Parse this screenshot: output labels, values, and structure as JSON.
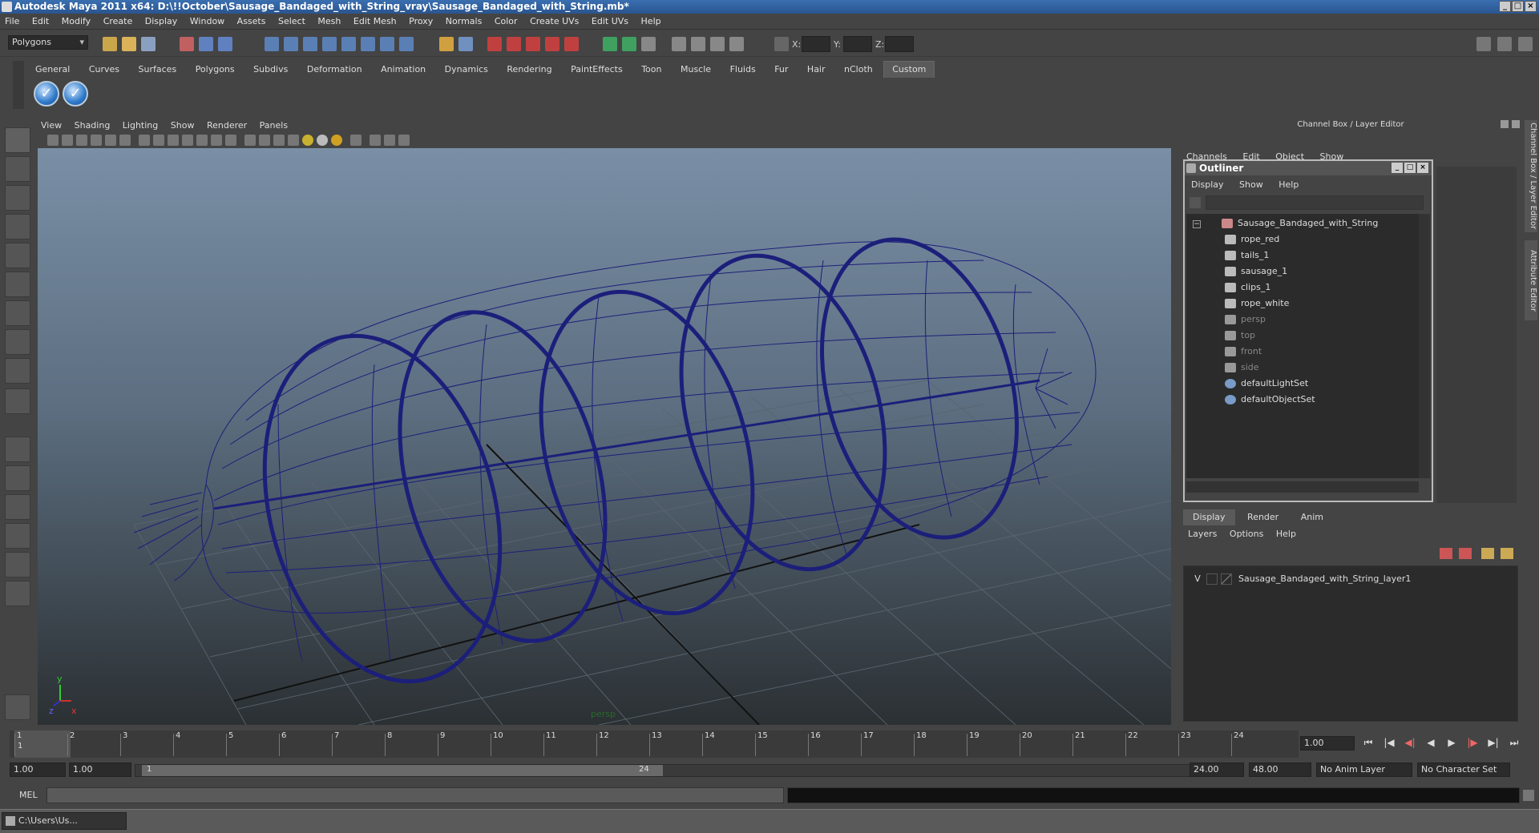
{
  "window": {
    "title": "Autodesk Maya 2011 x64: D:\\!!October\\Sausage_Bandaged_with_String_vray\\Sausage_Bandaged_with_String.mb*"
  },
  "menubar": [
    "File",
    "Edit",
    "Modify",
    "Create",
    "Display",
    "Window",
    "Assets",
    "Select",
    "Mesh",
    "Edit Mesh",
    "Proxy",
    "Normals",
    "Color",
    "Create UVs",
    "Edit UVs",
    "Help"
  ],
  "statusline": {
    "mode": "Polygons",
    "x_label": "X:",
    "y_label": "Y:",
    "z_label": "Z:"
  },
  "shelf": {
    "tabs": [
      "General",
      "Curves",
      "Surfaces",
      "Polygons",
      "Subdivs",
      "Deformation",
      "Animation",
      "Dynamics",
      "Rendering",
      "PaintEffects",
      "Toon",
      "Muscle",
      "Fluids",
      "Fur",
      "Hair",
      "nCloth",
      "Custom"
    ],
    "active_tab": "Custom"
  },
  "viewport": {
    "menu": [
      "View",
      "Shading",
      "Lighting",
      "Show",
      "Renderer",
      "Panels"
    ],
    "camera_label": "persp",
    "axis_y": "y",
    "axis_z": "z",
    "axis_x": "x",
    "wire_color": "#1c1f7a"
  },
  "channel_box": {
    "title": "Channel Box / Layer Editor",
    "menu": [
      "Channels",
      "Edit",
      "Object",
      "Show"
    ]
  },
  "side_tabs": {
    "tab1": "Channel Box / Layer Editor",
    "tab2": "Attribute Editor"
  },
  "outliner": {
    "title": "Outliner",
    "menu": [
      "Display",
      "Show",
      "Help"
    ],
    "nodes": [
      {
        "label": "Sausage_Bandaged_with_String"
      },
      {
        "label": "rope_red"
      },
      {
        "label": "tails_1"
      },
      {
        "label": "sausage_1"
      },
      {
        "label": "clips_1"
      },
      {
        "label": "rope_white"
      },
      {
        "label": "persp"
      },
      {
        "label": "top"
      },
      {
        "label": "front"
      },
      {
        "label": "side"
      },
      {
        "label": "defaultLightSet"
      },
      {
        "label": "defaultObjectSet"
      }
    ]
  },
  "layer_editor": {
    "tabs": [
      "Display",
      "Render",
      "Anim"
    ],
    "active_tab": "Display",
    "menu": [
      "Layers",
      "Options",
      "Help"
    ],
    "layers": [
      {
        "visible": "V",
        "name": "Sausage_Bandaged_with_String_layer1"
      }
    ]
  },
  "timeline": {
    "ticks": [
      "1",
      "2",
      "3",
      "4",
      "5",
      "6",
      "7",
      "8",
      "9",
      "10",
      "11",
      "12",
      "13",
      "14",
      "15",
      "16",
      "17",
      "18",
      "19",
      "20",
      "21",
      "22",
      "23",
      "24"
    ],
    "current_frame_marker": "1",
    "current_frame": "1.00"
  },
  "range": {
    "start": "1.00",
    "playback_start": "1.00",
    "slider_start": "1",
    "slider_end": "24",
    "playback_end": "24.00",
    "end": "48.00",
    "anim_layer": "No Anim Layer",
    "character_set": "No Character Set"
  },
  "command_line": {
    "label": "MEL"
  },
  "taskbar": {
    "task_label": "C:\\Users\\Us..."
  }
}
